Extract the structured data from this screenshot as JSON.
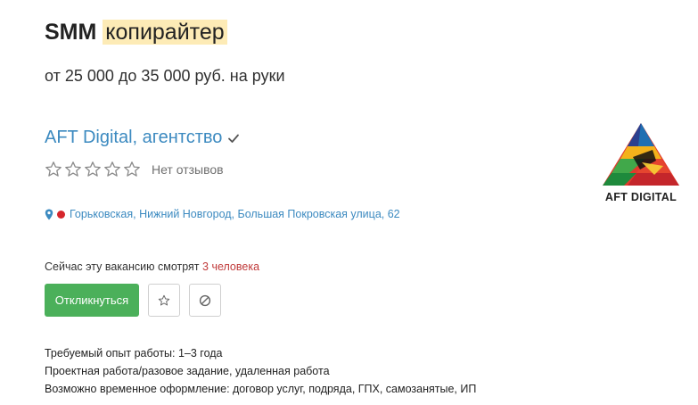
{
  "vacancy": {
    "title_prefix": "SMM",
    "title_highlight": "копирайтер",
    "salary": "от 25 000 до 35 000 руб. на руки"
  },
  "company": {
    "name": "AFT Digital, агентство",
    "verified_icon": "checkmark-icon",
    "rating_stars": 0,
    "rating_max": 5,
    "reviews_label": "Нет отзывов",
    "logo_text": "AFT DIGITAL"
  },
  "address": {
    "metro_color": "#d6262c",
    "text": "Горьковская, Нижний Новгород, Большая Покровская улица, 62"
  },
  "viewers": {
    "prefix": "Сейчас эту вакансию смотрят",
    "count": "3 человека"
  },
  "actions": {
    "apply_label": "Откликнуться",
    "favorite_icon": "star-icon",
    "hide_icon": "block-icon"
  },
  "details": {
    "experience": "Требуемый опыт работы: 1–3 года",
    "employment": "Проектная работа/разовое задание, удаленная работа",
    "contract": "Возможно временное оформление: договор услуг, подряда, ГПХ, самозанятые, ИП"
  },
  "colors": {
    "link": "#3c8ac0",
    "apply_button": "#4bb05a",
    "highlight": "#fdebb6",
    "viewer_count": "#c03a3a"
  }
}
